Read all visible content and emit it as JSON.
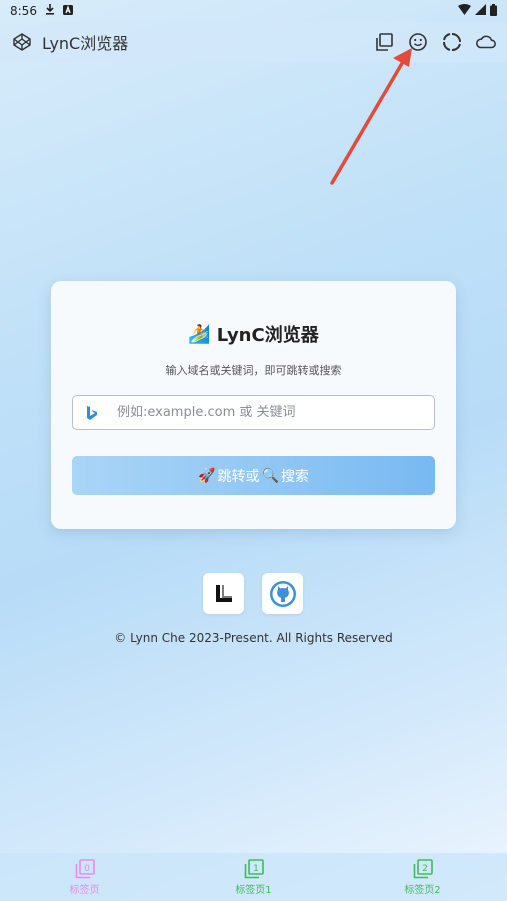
{
  "status_bar": {
    "time": "8:56"
  },
  "app_bar": {
    "title": "LynC浏览器"
  },
  "card": {
    "title_emoji": "🏄",
    "title": "LynC浏览器",
    "subtitle": "输入域名或关键词，即可跳转或搜索",
    "search": {
      "placeholder": "例如:example.com 或 关键词",
      "value": ""
    },
    "go_button": {
      "prefix_emoji": "🚀",
      "text1": "跳转或",
      "mid_emoji": "🔍",
      "text2": "搜索"
    }
  },
  "footer": {
    "copyright": "© Lynn Che 2023-Present. All Rights Reserved"
  },
  "tabs": [
    {
      "number": "0",
      "label": "标签页",
      "color": "#e38ee8"
    },
    {
      "number": "1",
      "label": "标签页1",
      "color": "#3cbf56"
    },
    {
      "number": "2",
      "label": "标签页2",
      "color": "#3cbf56"
    }
  ],
  "colors": {
    "accent_blue": "#78b9f2",
    "annotation_red": "#e24a3b"
  }
}
